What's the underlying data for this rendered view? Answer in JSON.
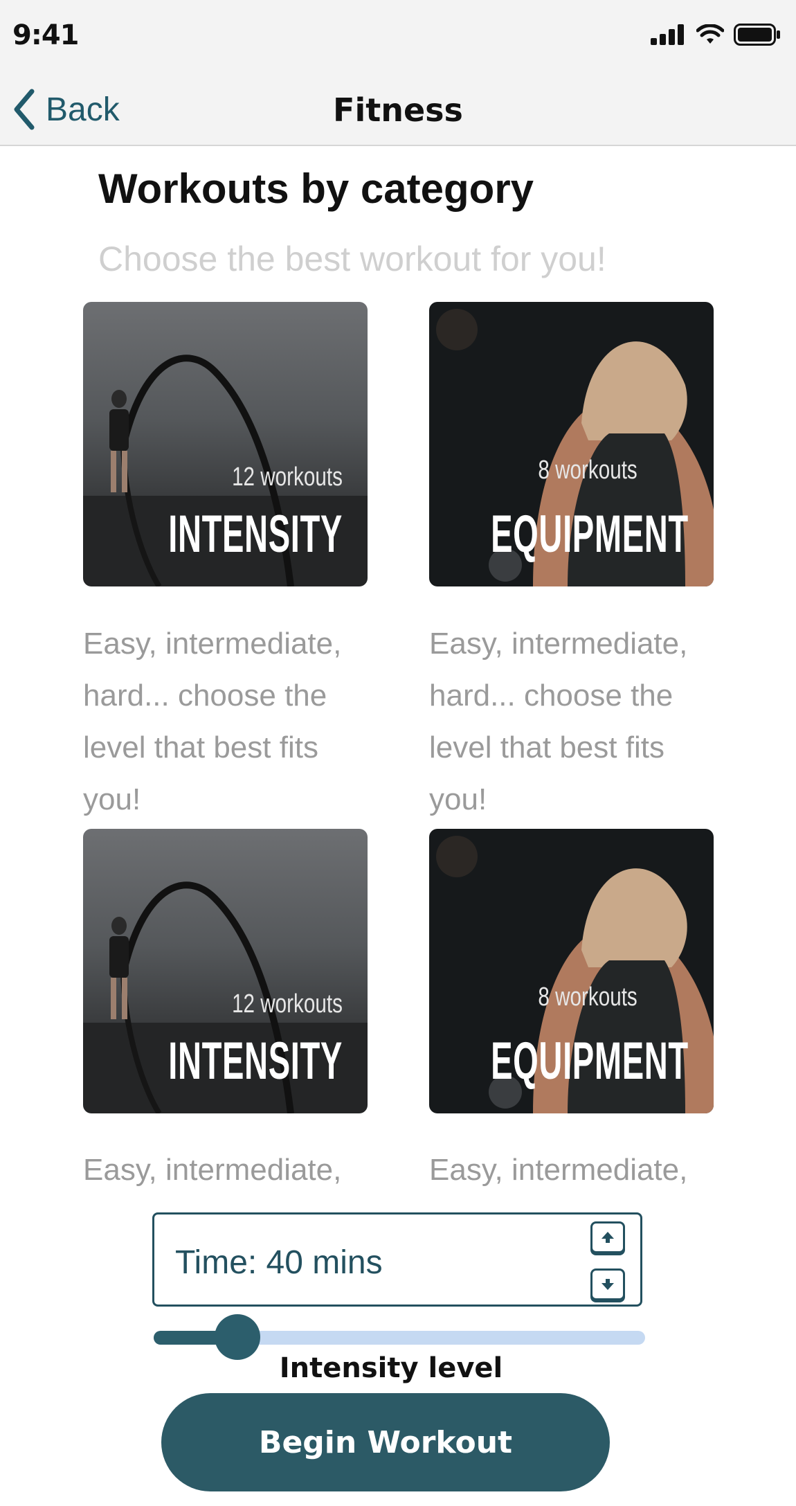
{
  "status_bar": {
    "time": "9:41"
  },
  "nav": {
    "back_label": "Back",
    "title": "Fitness"
  },
  "heading": "Workouts by category",
  "subheading": "Choose the best workout for you!",
  "cards": [
    {
      "count": "12 workouts",
      "name": "INTENSITY",
      "description": "Easy, intermediate, hard... choose the level that best fits you!"
    },
    {
      "count": "8 workouts",
      "name": "EQUIPMENT",
      "description": "Easy, intermediate, hard... choose the level that best fits you!"
    },
    {
      "count": "12 workouts",
      "name": "INTENSITY",
      "description": "Easy, intermediate,"
    },
    {
      "count": "8 workouts",
      "name": "EQUIPMENT",
      "description": "Easy, intermediate,"
    }
  ],
  "time_stepper": {
    "value": "Time: 40 mins"
  },
  "intensity_slider": {
    "label": "Intensity level",
    "value": 0.17
  },
  "begin_button": {
    "label": "Begin Workout"
  },
  "colors": {
    "accent": "#2c5a66",
    "track": "#c5d9f2",
    "text_muted": "#9a9a9a"
  },
  "icons": [
    "back-chevron-icon",
    "signal-icon",
    "wifi-icon",
    "battery-icon",
    "arrow-up-icon",
    "arrow-down-icon"
  ]
}
